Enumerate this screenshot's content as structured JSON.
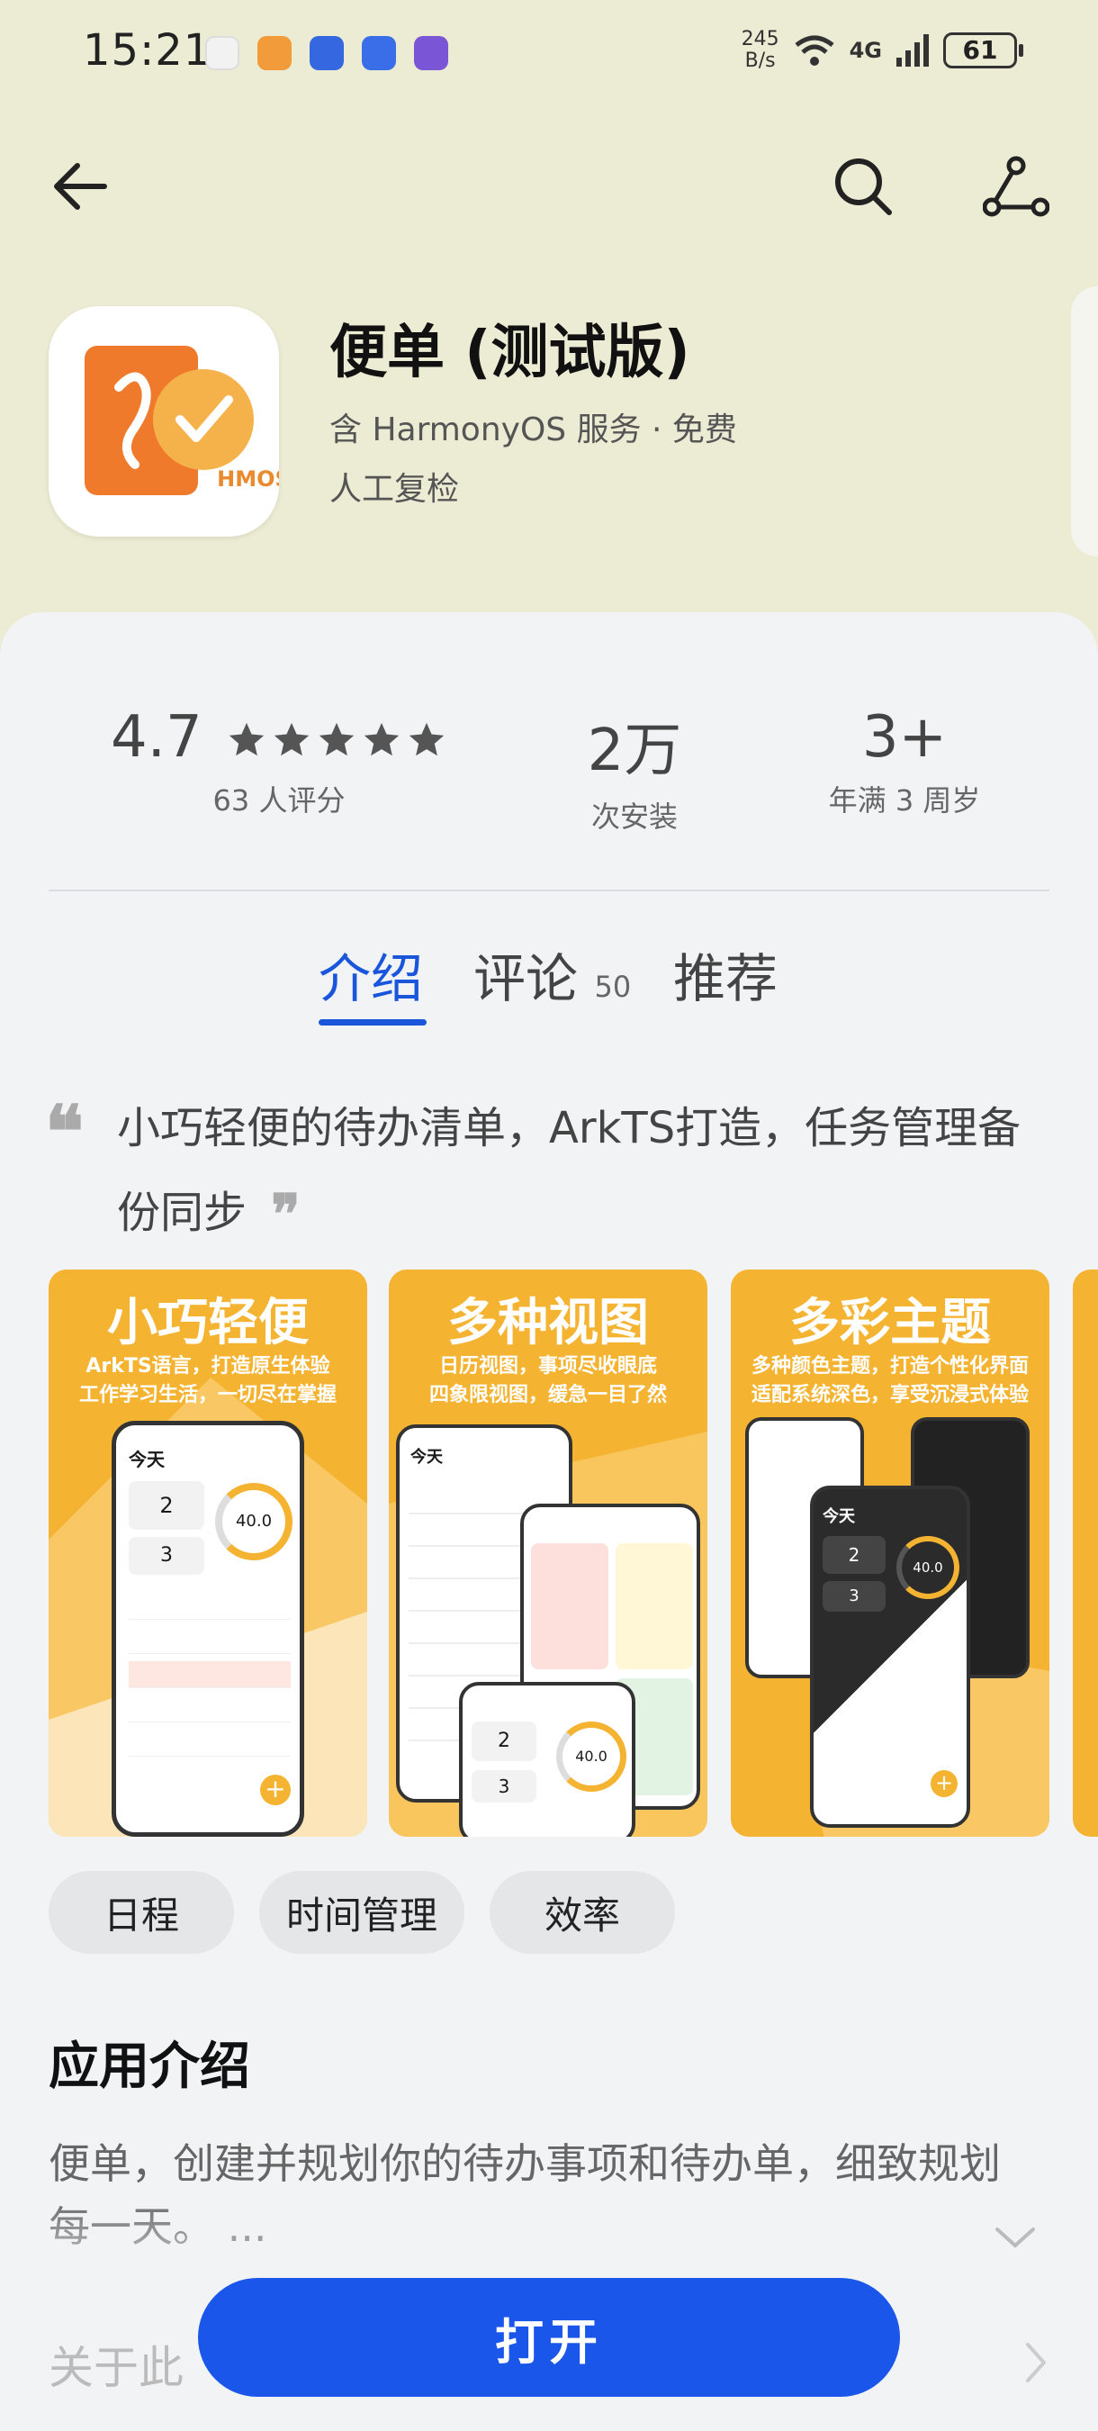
{
  "status_bar": {
    "time": "15:21",
    "net_speed_value": "245",
    "net_speed_unit": "B/s",
    "network": "4G",
    "battery": "61"
  },
  "nav": {
    "back_icon": "back-arrow-icon",
    "search_icon": "search-icon",
    "share_icon": "share-icon"
  },
  "app": {
    "name": "便单 (测试版)",
    "meta": "含 HarmonyOS 服务 · 免费",
    "review_note": "人工复检",
    "icon_text": "HMOS"
  },
  "stats": {
    "rating": "4.7",
    "rating_count": "63 人评分",
    "installs": "2万",
    "installs_label": "次安装",
    "age": "3+",
    "age_label": "年满 3 周岁"
  },
  "tabs": [
    {
      "label": "介绍",
      "active": true
    },
    {
      "label": "评论",
      "count": "50"
    },
    {
      "label": "推荐"
    }
  ],
  "tagline": "小巧轻便的待办清单，ArkTS打造，任务管理备份同步",
  "screenshots": [
    {
      "title": "小巧轻便",
      "subtitle_1": "ArkTS语言，打造原生体验",
      "subtitle_2": "工作学习生活，一切尽在掌握",
      "today": "今天",
      "num1": "2",
      "num2": "3",
      "gauge": "40.0"
    },
    {
      "title": "多种视图",
      "subtitle_1": "日历视图，事项尽收眼底",
      "subtitle_2": "四象限视图，缓急一目了然",
      "today": "今天",
      "num1": "2",
      "num2": "3",
      "gauge": "40.0"
    },
    {
      "title": "多彩主题",
      "subtitle_1": "多种颜色主题，打造个性化界面",
      "subtitle_2": "适配系统深色，享受沉浸式体验",
      "today": "今天",
      "num1": "2",
      "num2": "3",
      "gauge": "40.0"
    }
  ],
  "tags": [
    "日程",
    "时间管理",
    "效率"
  ],
  "intro": {
    "title": "应用介绍",
    "text": "便单，创建并规划你的待办事项和待办单，细致规划每一天。 ..."
  },
  "about_label": "关于此",
  "open_button": "打开",
  "colors": {
    "accent": "#1a56ea",
    "header_bg": "#ecebd3",
    "sheet_bg": "#f1f3f5",
    "screenshot_bg": "#f5b332"
  }
}
